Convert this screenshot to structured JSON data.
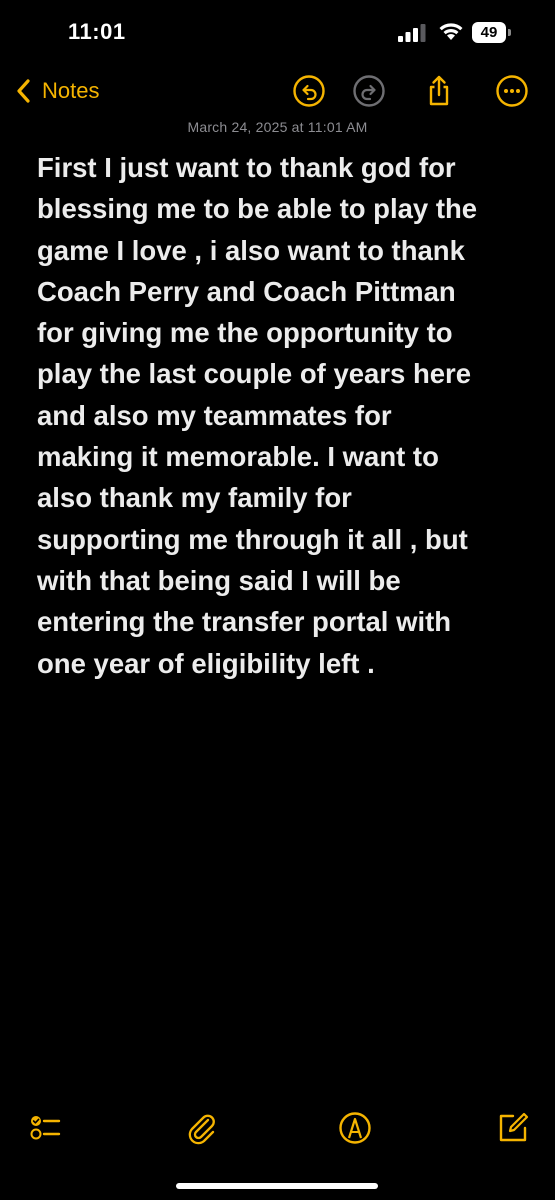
{
  "status_bar": {
    "time": "11:01",
    "battery_level": "49",
    "signal_bars": 3,
    "wifi_icon": "wifi-icon"
  },
  "nav": {
    "back_label": "Notes",
    "icons": [
      "undo-icon",
      "redo-icon",
      "share-icon",
      "more-icon"
    ]
  },
  "note": {
    "date": "March 24, 2025 at 11:01 AM",
    "lines": [
      "First I just want to thank god for",
      "blessing me to be able to play the",
      "game I love , i also want to thank",
      "Coach Perry and Coach Pittman",
      "for giving me the opportunity to",
      "play the last couple of years here",
      "and also my teammates for",
      "making it memorable. I want to",
      "also thank my family for",
      "supporting me through it all , but",
      "with that being said I will be",
      "entering the transfer portal with",
      "one year of eligibility left ."
    ]
  },
  "toolbar": {
    "icons": [
      "checklist-icon",
      "paperclip-icon",
      "markup-pen-icon",
      "compose-icon"
    ]
  },
  "colors": {
    "background": "#000000",
    "accent": "#f5b400",
    "text": "#ececec",
    "date_text": "#8d8d92",
    "disabled_icon": "#6e6e72"
  }
}
